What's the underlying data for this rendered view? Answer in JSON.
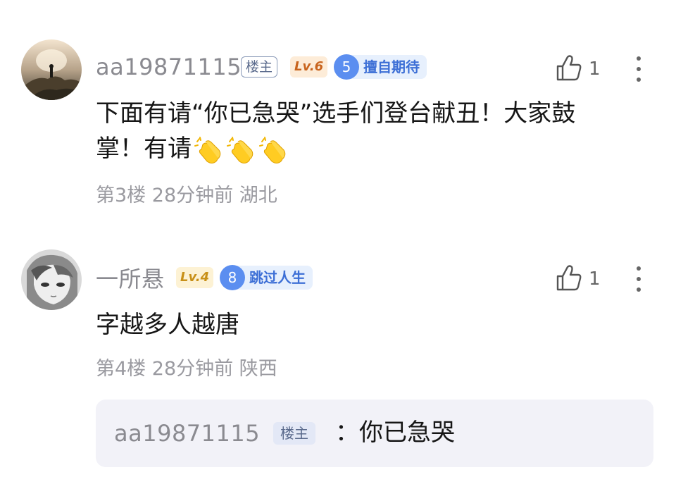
{
  "comments": [
    {
      "username": "aa19871115",
      "host_badge": "楼主",
      "level": "Lv.6",
      "medal_level": "5",
      "medal_name": "擅自期待",
      "likes": "1",
      "text_line1": "下面有请“你已急哭”选手们登台献丑！大家鼓",
      "text_line2": "掌！有请",
      "emoji_count": 3,
      "emoji_icon": "clapping-hands-icon",
      "meta": "第3楼 28分钟前 湖北"
    },
    {
      "username": "一所悬",
      "level": "Lv.4",
      "medal_level": "8",
      "medal_name": "跳过人生",
      "likes": "1",
      "text": "字越多人越唐",
      "meta": "第4楼 28分钟前 陕西",
      "reply": {
        "username": "aa19871115",
        "host_badge": "楼主",
        "text": "：你已急哭"
      }
    }
  ],
  "colors": {
    "accent_blue": "#3d6fd6",
    "lv6": "#c8641e",
    "lv4": "#c89018",
    "meta_gray": "#9a9aa0"
  }
}
